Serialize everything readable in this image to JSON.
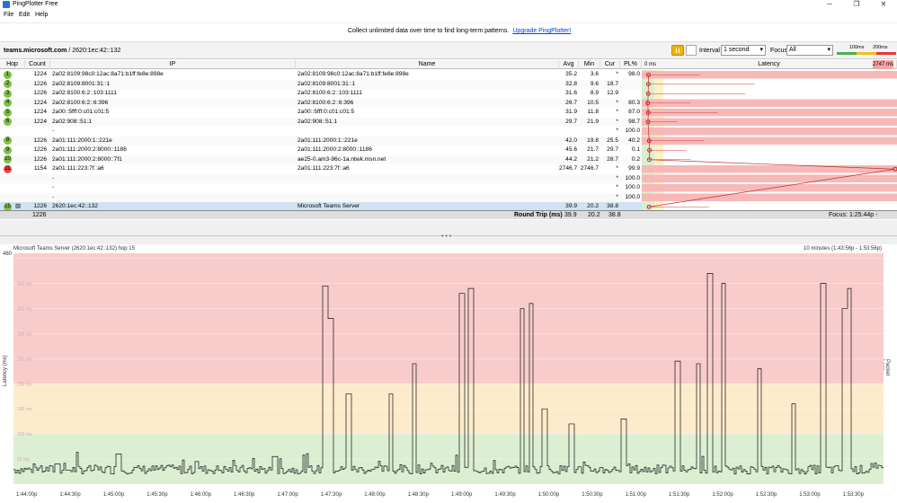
{
  "window": {
    "title": "PingPlotter Free",
    "minimize_icon": "minimize-icon",
    "maximize_icon": "maximize-icon",
    "close_icon": "close-icon"
  },
  "menu": [
    "File",
    "Edit",
    "Help"
  ],
  "banner": {
    "text": "Collect unlimited data over time to find long-term patterns.",
    "link": "Upgrade PingPlotter!"
  },
  "toolbar": {
    "target_host": "teams.microsoft.com",
    "target_ip": "/ 2620:1ec:42::132",
    "interval_label": "Interval",
    "interval_value": "1 second",
    "focus_label": "Focus",
    "focus_value": "All",
    "scale_100": "100ms",
    "scale_200": "200ms"
  },
  "columns": {
    "hop": "Hop",
    "count": "Count",
    "ip": "IP",
    "name": "Name",
    "avg": "Avg",
    "min": "Min",
    "cur": "Cur",
    "pl": "PL%",
    "lat_min": "0 ms",
    "latency": "Latency",
    "lat_max": "2747 ms"
  },
  "hops": [
    {
      "hop": "1",
      "count": "1224",
      "ip": "2a02:8109:98c0:12ac:8a71:b1ff:fe8e:898e",
      "name": "2a02:8109:98c0:12ac:8a71:b1ff:fe8e:898e",
      "avg": "35.2",
      "min": "3.6",
      "cur": "*",
      "pl": "98.0",
      "color": "#7bc043",
      "lat": 35.2,
      "min_v": 3.6,
      "max_v": 600
    },
    {
      "hop": "2",
      "count": "1226",
      "ip": "2a02:8109:8001:31::1",
      "name": "2a02:8109:8001:31::1",
      "avg": "32.8",
      "min": "9.6",
      "cur": "18.7",
      "pl": "",
      "color": "#7bc043",
      "lat": 32.8,
      "min_v": 9.6,
      "max_v": 1200
    },
    {
      "hop": "3",
      "count": "1226",
      "ip": "2a02:8100:6:2::103:1111",
      "name": "2a02:8100:6:2::103:1111",
      "avg": "31.6",
      "min": "8.9",
      "cur": "12.9",
      "pl": "",
      "color": "#7bc043",
      "lat": 31.6,
      "min_v": 8.9,
      "max_v": 1100
    },
    {
      "hop": "4",
      "count": "1224",
      "ip": "2a02:8100:6:2::6:396",
      "name": "2a02:8100:6:2::6:396",
      "avg": "26.7",
      "min": "10.5",
      "cur": "*",
      "pl": "80.3",
      "color": "#7bc043",
      "lat": 26.7,
      "min_v": 10.5,
      "max_v": 500
    },
    {
      "hop": "5",
      "count": "1224",
      "ip": "2a00::5fff:0:c01:c01:5",
      "name": "2a00::5fff:0:c01:c01:5",
      "avg": "31.9",
      "min": "11.8",
      "cur": "*",
      "pl": "87.0",
      "color": "#7bc043",
      "lat": 31.9,
      "min_v": 11.8,
      "max_v": 800
    },
    {
      "hop": "6",
      "count": "1224",
      "ip": "2a02:908::51:1",
      "name": "2a02:908::51:1",
      "avg": "29.7",
      "min": "21.9",
      "cur": "*",
      "pl": "98.7",
      "color": "#7bc043",
      "lat": 29.7,
      "min_v": 21.9,
      "max_v": 350
    },
    {
      "hop": "",
      "count": "",
      "ip": "-",
      "name": "",
      "avg": "",
      "min": "",
      "cur": "*",
      "pl": "100.0",
      "color": "",
      "lat": null
    },
    {
      "hop": "8",
      "count": "1226",
      "ip": "2a01:111:2000:1::221e",
      "name": "2a01:111:2000:1::221e",
      "avg": "42.0",
      "min": "19.8",
      "cur": "25.5",
      "pl": "40.2",
      "color": "#7bc043",
      "lat": 42.0,
      "min_v": 19.8,
      "max_v": 650
    },
    {
      "hop": "9",
      "count": "1226",
      "ip": "2a01:111:2000:2:8000::1186",
      "name": "2a01:111:2000:2:8000::1186",
      "avg": "45.6",
      "min": "21.7",
      "cur": "29.7",
      "pl": "0.1",
      "color": "#7bc043",
      "lat": 45.6,
      "min_v": 21.7,
      "max_v": 450
    },
    {
      "hop": "10",
      "count": "1226",
      "ip": "2a01:111:2000:2:8000::7f1",
      "name": "ae25-0.am3-96c-1a.ntwk.msn.net",
      "avg": "44.2",
      "min": "21.2",
      "cur": "28.7",
      "pl": "0.2",
      "color": "#7bc043",
      "lat": 44.2,
      "min_v": 21.2,
      "max_v": 500
    },
    {
      "hop": "11",
      "count": "1154",
      "ip": "2a01:111:223:7f::a6",
      "name": "2a01:111:223:7f::a6",
      "avg": "2746.7",
      "min": "2746.7",
      "cur": "*",
      "pl": "99.9",
      "color": "#e8473e",
      "lat": 2746.7,
      "min_v": 2746.7,
      "max_v": 2746.7
    },
    {
      "hop": "",
      "count": "",
      "ip": "-",
      "name": "",
      "avg": "",
      "min": "",
      "cur": "*",
      "pl": "100.0",
      "color": "",
      "lat": null
    },
    {
      "hop": "",
      "count": "",
      "ip": "-",
      "name": "",
      "avg": "",
      "min": "",
      "cur": "*",
      "pl": "100.0",
      "color": "",
      "lat": null
    },
    {
      "hop": "",
      "count": "",
      "ip": "-",
      "name": "",
      "avg": "",
      "min": "",
      "cur": "*",
      "pl": "100.0",
      "color": "",
      "lat": null
    },
    {
      "hop": "15",
      "count": "1226",
      "ip": "2620:1ec:42::132",
      "name": "Microsoft Teams Server",
      "avg": "39.9",
      "min": "20.2",
      "cur": "38.8",
      "pl": "",
      "color": "#7bc043",
      "lat": 39.9,
      "min_v": 20.2,
      "max_v": 700
    }
  ],
  "summary": {
    "count": "1226",
    "label": "Round Trip (ms)",
    "avg": "39.9",
    "min": "20.2",
    "cur": "38.8",
    "focus": "Focus: 1:25:44p - 1:53:56p"
  },
  "graph": {
    "title": "Microsoft Teams Server (2620:1ec:42::132) hop 15",
    "range": "10 minutes (1:43:56p - 1:53:56p)",
    "y_label": "Latency (ms)",
    "y_right_label": "Packet Loss %",
    "y_max": "460",
    "y_ticks": [
      "400 ms",
      "350 ms",
      "300 ms",
      "250 ms",
      "200 ms",
      "150 ms",
      "100 ms",
      "50 ms"
    ],
    "x_ticks": [
      "1:44:00p",
      "1:44:30p",
      "1:45:00p",
      "1:45:30p",
      "1:46:00p",
      "1:46:30p",
      "1:47:00p",
      "1:47:30p",
      "1:48:00p",
      "1:48:30p",
      "1:49:00p",
      "1:49:30p",
      "1:50:00p",
      "1:50:30p",
      "1:51:00p",
      "1:51:30p",
      "1:52:00p",
      "1:52:30p",
      "1:53:00p",
      "1:53:30p"
    ]
  },
  "chart_data": {
    "type": "line",
    "title": "Microsoft Teams Server (2620:1ec:42::132) hop 15",
    "ylabel": "Latency (ms)",
    "ylim": [
      0,
      460
    ],
    "spikes": [
      {
        "t": 0.05,
        "v": 40
      },
      {
        "t": 0.12,
        "v": 60
      },
      {
        "t": 0.21,
        "v": 45
      },
      {
        "t": 0.3,
        "v": 55
      },
      {
        "t": 0.357,
        "v": 395
      },
      {
        "t": 0.364,
        "v": 330
      },
      {
        "t": 0.384,
        "v": 180
      },
      {
        "t": 0.433,
        "v": 180
      },
      {
        "t": 0.46,
        "v": 240
      },
      {
        "t": 0.514,
        "v": 380
      },
      {
        "t": 0.525,
        "v": 390
      },
      {
        "t": 0.584,
        "v": 350
      },
      {
        "t": 0.594,
        "v": 360
      },
      {
        "t": 0.61,
        "v": 150
      },
      {
        "t": 0.64,
        "v": 120
      },
      {
        "t": 0.7,
        "v": 130
      },
      {
        "t": 0.762,
        "v": 245
      },
      {
        "t": 0.786,
        "v": 240
      },
      {
        "t": 0.8,
        "v": 420
      },
      {
        "t": 0.815,
        "v": 400
      },
      {
        "t": 0.856,
        "v": 230
      },
      {
        "t": 0.896,
        "v": 160
      },
      {
        "t": 0.93,
        "v": 400
      },
      {
        "t": 0.955,
        "v": 350
      },
      {
        "t": 0.96,
        "v": 390
      }
    ]
  }
}
